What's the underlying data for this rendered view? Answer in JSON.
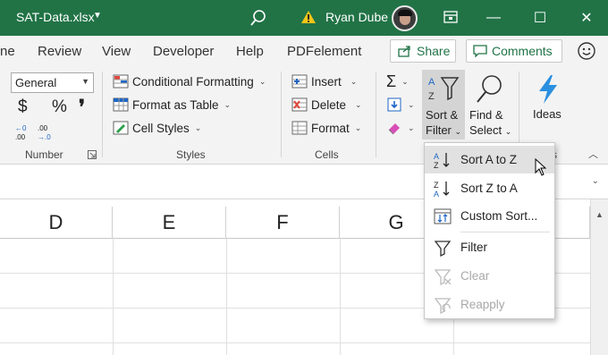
{
  "titlebar": {
    "filename": "SAT-Data.xlsx",
    "user_name": "Ryan Dube",
    "minimize": "—",
    "maximize": "☐",
    "close": "✕",
    "icons": [
      "search-icon",
      "warning-icon",
      "ribbon-display-icon"
    ]
  },
  "menu": {
    "tabs": [
      "ne",
      "Review",
      "View",
      "Developer",
      "Help",
      "PDFelement"
    ],
    "share_label": "Share",
    "comments_label": "Comments"
  },
  "ribbon": {
    "number": {
      "format_value": "General",
      "currency_symbol": "$",
      "percent_symbol": "%",
      "comma_symbol": "❜",
      "label": "Number"
    },
    "styles": {
      "conditional_formatting": "Conditional Formatting",
      "format_as_table": "Format as Table",
      "cell_styles": "Cell Styles",
      "label": "Styles"
    },
    "cells": {
      "insert": "Insert",
      "delete": "Delete",
      "format": "Format",
      "label": "Cells"
    },
    "editing": {
      "sort_filter_line1": "Sort &",
      "sort_filter_line2": "Filter",
      "find_select_line1": "Find &",
      "find_select_line2": "Select",
      "label_partial": "s"
    },
    "ideas": {
      "label": "Ideas"
    }
  },
  "grid": {
    "columns": [
      "D",
      "E",
      "F",
      "G"
    ]
  },
  "sort_menu": {
    "items": [
      {
        "label": "Sort A to Z",
        "enabled": true,
        "hovered": true
      },
      {
        "label": "Sort Z to A",
        "enabled": true,
        "hovered": false
      },
      {
        "label": "Custom Sort...",
        "enabled": true,
        "hovered": false
      },
      {
        "label": "Filter",
        "enabled": true,
        "hovered": false
      },
      {
        "label": "Clear",
        "enabled": false,
        "hovered": false
      },
      {
        "label": "Reapply",
        "enabled": false,
        "hovered": false
      }
    ]
  },
  "colors": {
    "title_bg": "#217346",
    "accent_green": "#217346",
    "ribbon_bg": "#f3f3f3",
    "hover_bg": "#e1e1e1",
    "disabled_text": "#a8a8a8"
  }
}
